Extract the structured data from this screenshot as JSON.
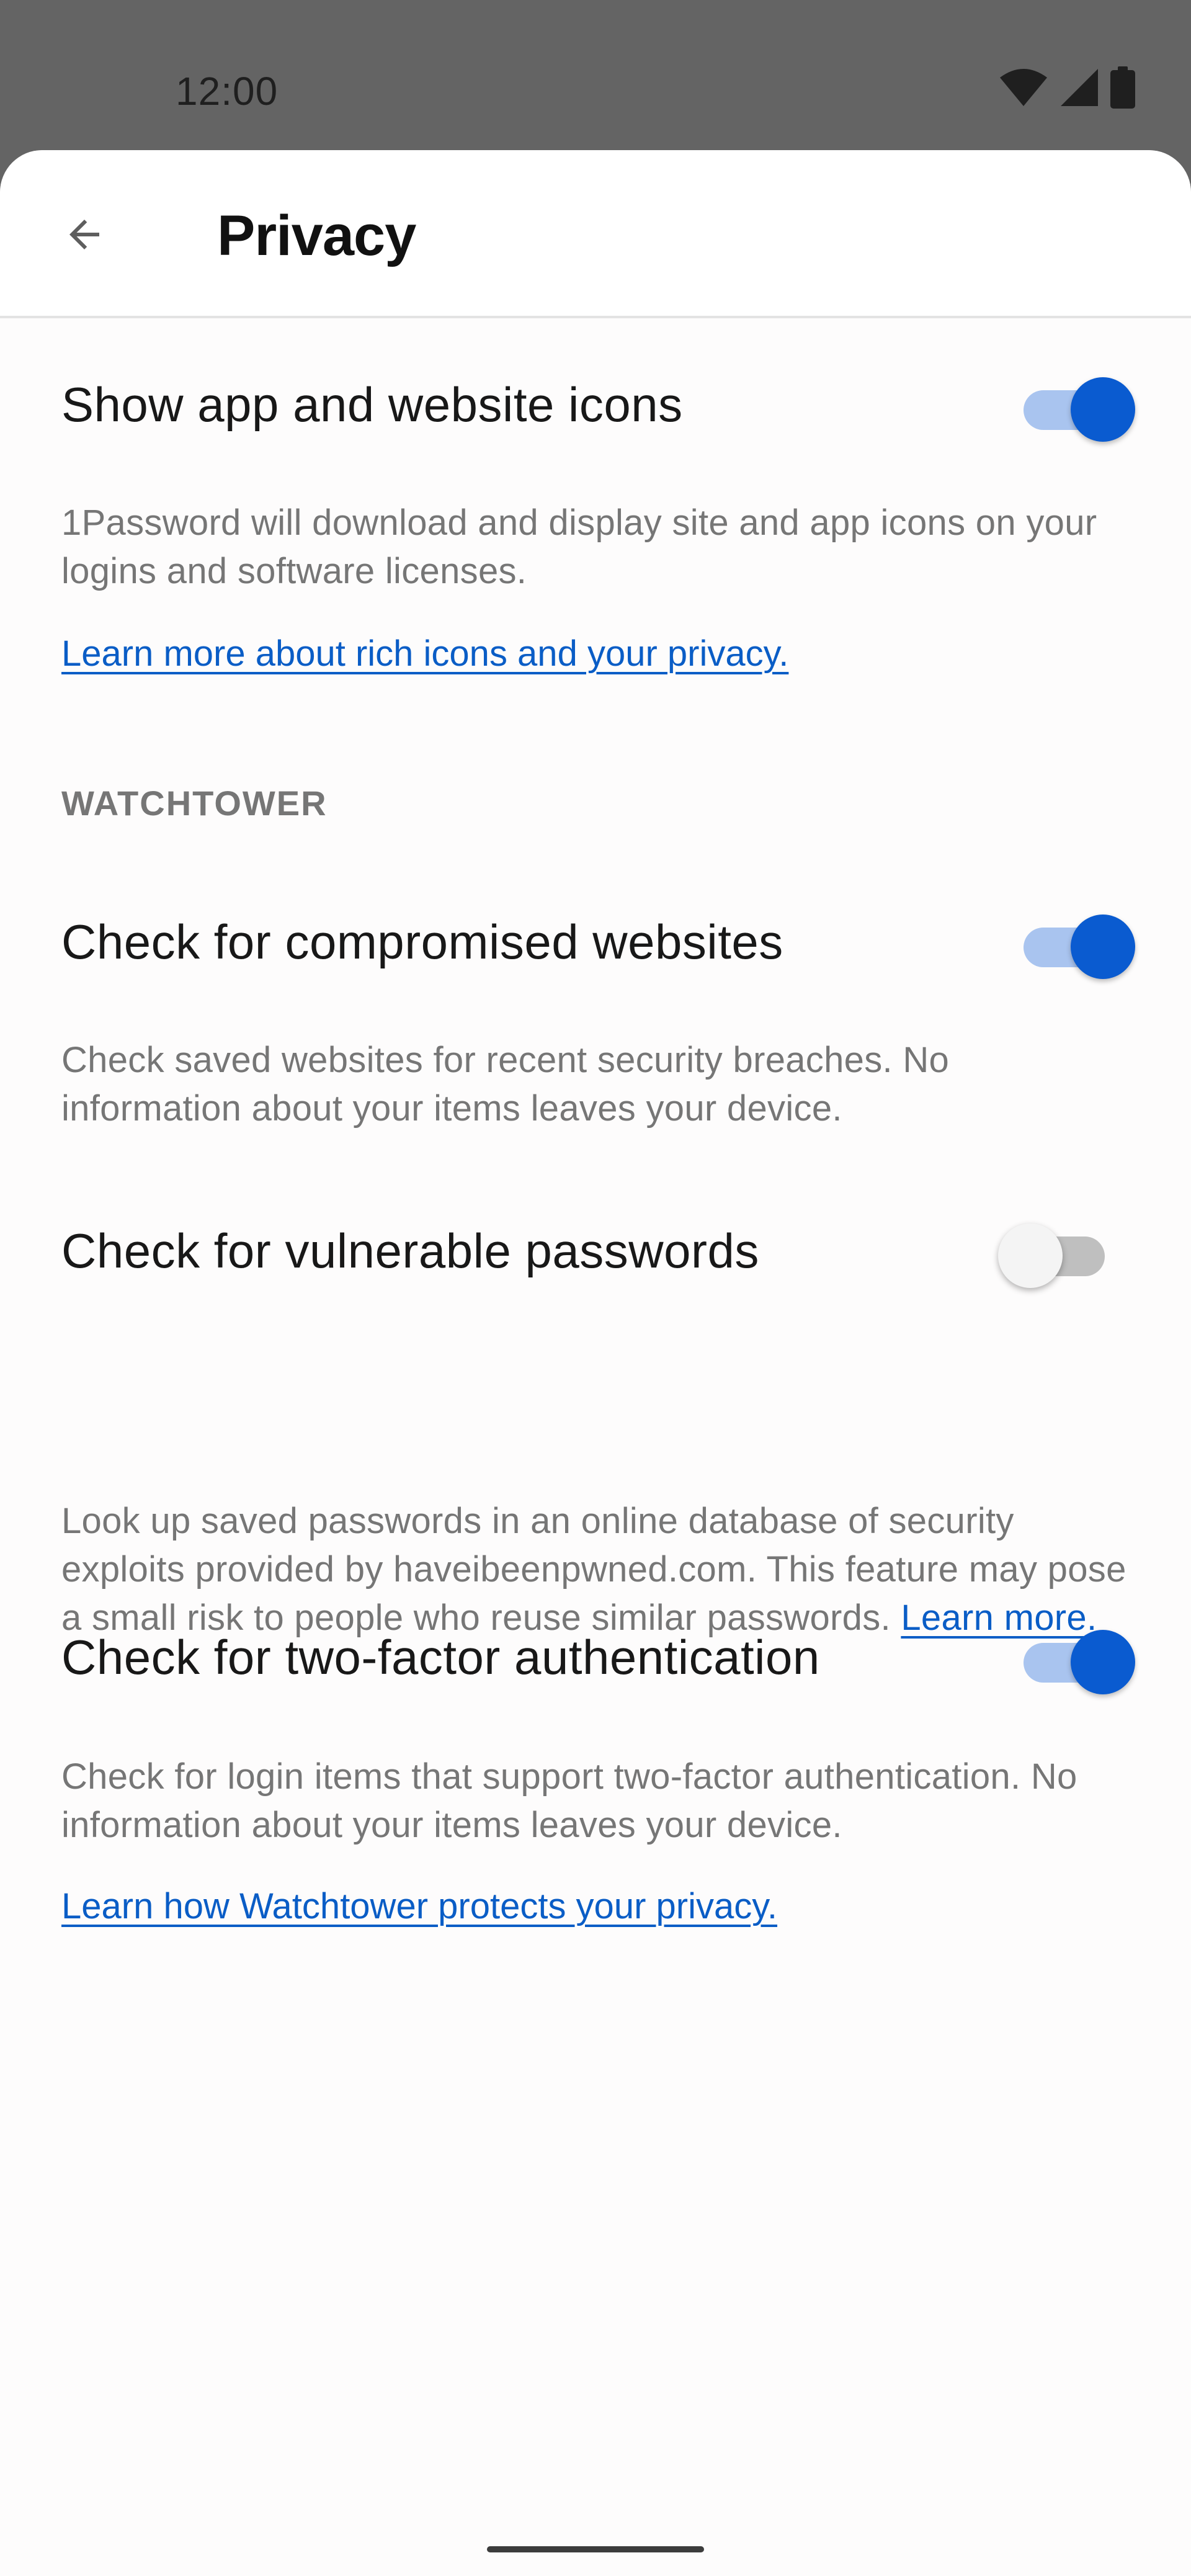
{
  "status_bar": {
    "time": "12:00"
  },
  "header": {
    "title": "Privacy",
    "back_icon": "arrow-back-icon"
  },
  "settings": {
    "icons": {
      "title": "Show app and website icons",
      "enabled": true,
      "description": "1Password will download and display site and app icons on your logins and software licenses.",
      "link": "Learn more about rich icons and your privacy."
    },
    "watchtower_header": "WATCHTOWER",
    "compromised": {
      "title": "Check for compromised websites",
      "enabled": true,
      "description": "Check saved websites for recent security breaches. No information about your items leaves your device."
    },
    "vulnerable": {
      "title": "Check for vulnerable passwords",
      "enabled": false,
      "description": "Look up saved passwords in an online database of security exploits provided by haveibeenpwned.com. This feature may pose a small risk to people who reuse similar passwords.",
      "link": "Learn more."
    },
    "two_factor": {
      "title": "Check for two-factor authentication",
      "enabled": true,
      "description": "Check for login items that support two-factor authentication. No information about your items leaves your device.",
      "link": "Learn how Watchtower protects your privacy."
    }
  },
  "colors": {
    "accent": "#0a5bd0",
    "link": "#0a5dc6",
    "toggle_track_on": "#a9c4ef",
    "secondary_text": "#767676"
  }
}
